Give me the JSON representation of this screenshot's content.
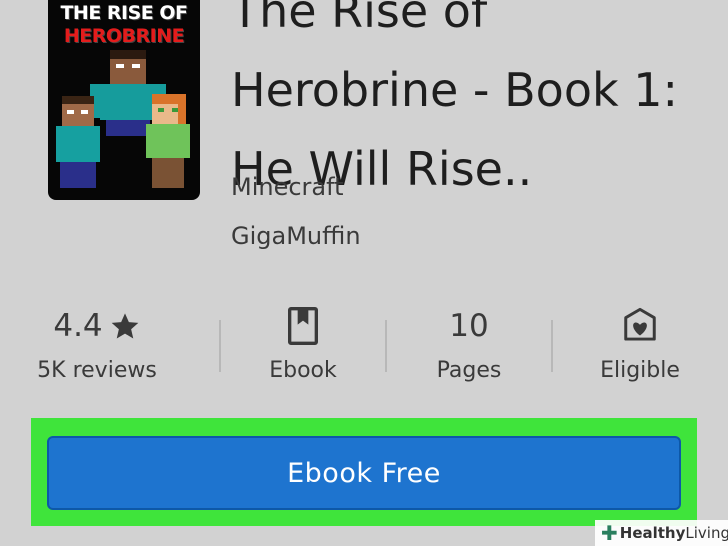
{
  "book": {
    "cover_title_line1": "THE RISE OF",
    "cover_title_line2": "HEROBRINE",
    "title": "The Rise of Herobrine - Book 1: He Will Rise..",
    "genre": "Minecraft",
    "author": "GigaMuffin"
  },
  "stats": [
    {
      "value": "4.4",
      "icon": "star-icon",
      "label": "5K reviews"
    },
    {
      "icon": "bookmark-icon",
      "label": "Ebook"
    },
    {
      "value": "10",
      "label": "Pages"
    },
    {
      "icon": "shield-heart-icon",
      "label": "Eligible"
    }
  ],
  "cta": {
    "label": "Ebook Free"
  },
  "watermark": {
    "text_bold": "Healthy",
    "text_rest": " Living"
  },
  "colors": {
    "background": "#d2d2d2",
    "button": "#1e74cf",
    "highlight": "#3fe43b"
  }
}
